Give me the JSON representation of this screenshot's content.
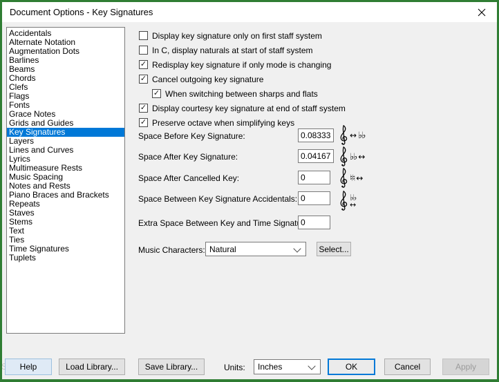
{
  "window": {
    "title": "Document Options - Key Signatures"
  },
  "sidebar": {
    "selected_index": 11,
    "items": [
      "Accidentals",
      "Alternate Notation",
      "Augmentation Dots",
      "Barlines",
      "Beams",
      "Chords",
      "Clefs",
      "Flags",
      "Fonts",
      "Grace Notes",
      "Grids and Guides",
      "Key Signatures",
      "Layers",
      "Lines and Curves",
      "Lyrics",
      "Multimeasure Rests",
      "Music Spacing",
      "Notes and Rests",
      "Piano Braces and Brackets",
      "Repeats",
      "Staves",
      "Stems",
      "Text",
      "Ties",
      "Time Signatures",
      "Tuplets"
    ]
  },
  "options": [
    {
      "label": "Display key signature only on first staff system",
      "checked": false,
      "indent": false
    },
    {
      "label": "In C, display naturals at start of staff system",
      "checked": false,
      "indent": false
    },
    {
      "label": "Redisplay key signature if only mode is changing",
      "checked": true,
      "indent": false
    },
    {
      "label": "Cancel outgoing key signature",
      "checked": true,
      "indent": false
    },
    {
      "label": "When switching between sharps and flats",
      "checked": true,
      "indent": true
    },
    {
      "label": "Display courtesy key signature at end of staff system",
      "checked": true,
      "indent": false
    },
    {
      "label": "Preserve octave when simplifying keys",
      "checked": true,
      "indent": false
    }
  ],
  "spacing_fields": [
    {
      "label": "Space Before Key Signature:",
      "value": "0.08333",
      "icon_name": "clef-arrow-flats-icon",
      "icon": [
        "clef",
        "arrow",
        "flats"
      ]
    },
    {
      "label": "Space After Key Signature:",
      "value": "0.04167",
      "icon_name": "clef-flats-arrow-icon",
      "icon": [
        "clef",
        "flats",
        "arrow"
      ]
    },
    {
      "label": "Space After Cancelled Key:",
      "value": "0",
      "icon_name": "clef-naturals-arrow-icon",
      "icon": [
        "clef",
        "naturals",
        "arrow"
      ]
    },
    {
      "label": "Space Between Key Signature Accidentals:",
      "value": "0",
      "icon_name": "clef-flats-spacing-icon",
      "icon": [
        "clef",
        "flats-over-arrow"
      ]
    },
    {
      "label": "Extra Space Between Key and Time Signature:",
      "value": "0",
      "icon_name": null,
      "icon": []
    }
  ],
  "music_characters": {
    "label": "Music Characters:",
    "value": "Natural",
    "select_button": "Select..."
  },
  "glyphs": {
    "check": "✓",
    "arrow": "↔",
    "flats": "♭♭",
    "naturals": "♮♮"
  },
  "footer": {
    "help": "Help",
    "load_library": "Load Library...",
    "save_library": "Save Library...",
    "units_label": "Units:",
    "units_value": "Inches",
    "ok": "OK",
    "cancel": "Cancel",
    "apply": "Apply"
  },
  "artifact": {
    "snip": "Snip"
  },
  "colors": {
    "accent_blue": "#0078d7",
    "frame_green": "#2f7d33",
    "dialog_bg": "#f0f0f0",
    "selection_bg": "#0078d7"
  }
}
